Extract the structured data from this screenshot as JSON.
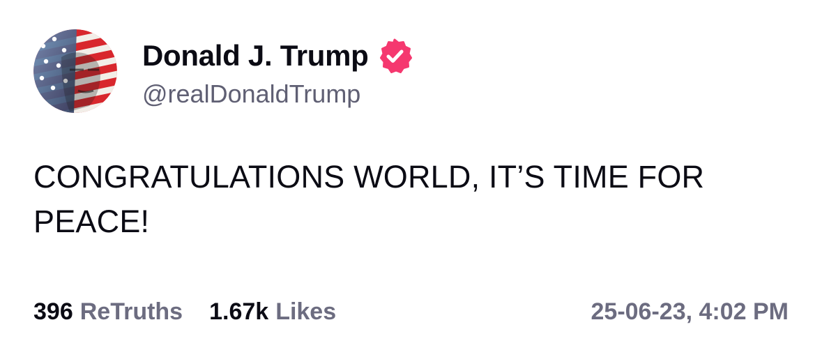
{
  "author": {
    "display_name": "Donald J. Trump",
    "handle": "@realDonaldTrump",
    "verified": true,
    "verified_color": "#f5386f"
  },
  "post": {
    "text": "CONGRATULATIONS WORLD, IT’S TIME FOR PEACE!"
  },
  "stats": {
    "retruths_count": "396",
    "retruths_label": "ReTruths",
    "likes_count": "1.67k",
    "likes_label": "Likes"
  },
  "timestamp": "25-06-23, 4:02 PM",
  "colors": {
    "text_primary": "#0b0b14",
    "text_secondary": "#6c6c80",
    "background": "#ffffff"
  },
  "icons": {
    "verified": "verified-badge-icon",
    "avatar": "avatar-image"
  }
}
